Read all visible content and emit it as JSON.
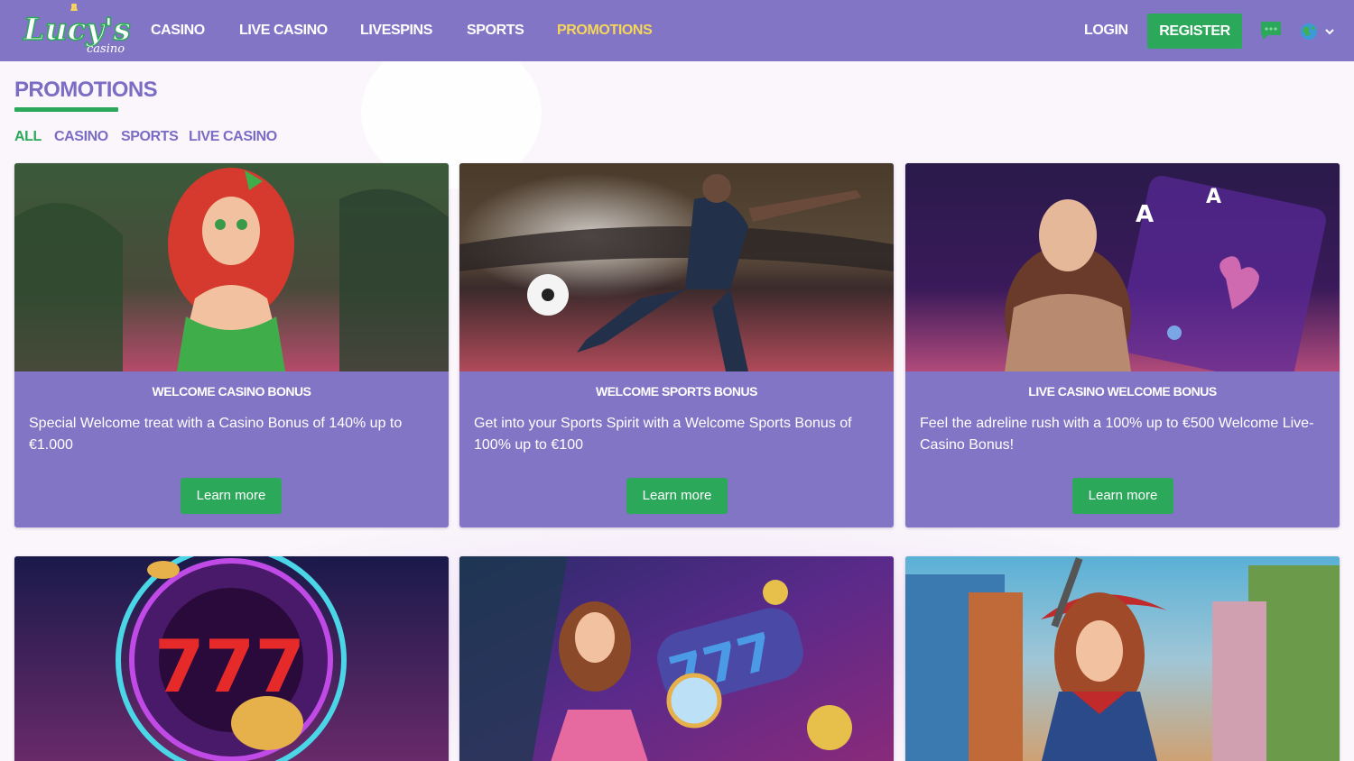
{
  "brand": {
    "logo_text": "Lucy's",
    "logo_sub": "casino"
  },
  "nav": {
    "items": [
      "CASINO",
      "LIVE CASINO",
      "LIVESPINS",
      "SPORTS",
      "PROMOTIONS"
    ],
    "active": "PROMOTIONS",
    "login_label": "LOGIN",
    "register_label": "REGISTER"
  },
  "icons": {
    "chat": "chat-bubble-icon",
    "language": "globe-icon",
    "dropdown": "chevron-down-icon"
  },
  "page": {
    "title": "PROMOTIONS",
    "filters": [
      "ALL",
      "CASINO",
      "SPORTS",
      "LIVE CASINO"
    ],
    "active_filter": "ALL"
  },
  "promotions": [
    {
      "title": "WELCOME CASINO BONUS",
      "description": "Special Welcome treat with a Casino Bonus of 140% up to €1.000",
      "button": "Learn more"
    },
    {
      "title": "WELCOME SPORTS BONUS",
      "description": "Get into your Sports Spirit with a Welcome Sports Bonus of 100% up to €100",
      "button": "Learn more"
    },
    {
      "title": "LIVE CASINO WELCOME BONUS",
      "description": "Feel the adreline rush with a 100% up to €500 Welcome Live-Casino Bonus!",
      "button": "Learn more"
    }
  ],
  "more_promotions": [
    {
      "image": "jackpot-wheel-777"
    },
    {
      "image": "anime-girl-slot-777"
    },
    {
      "image": "cowgirl-western-town"
    }
  ],
  "colors": {
    "header_bg": "#8275c6",
    "accent_green": "#2ca85a",
    "active_nav": "#f6d65a",
    "title_purple": "#7b6cc4",
    "page_bg": "#faf6fb"
  }
}
